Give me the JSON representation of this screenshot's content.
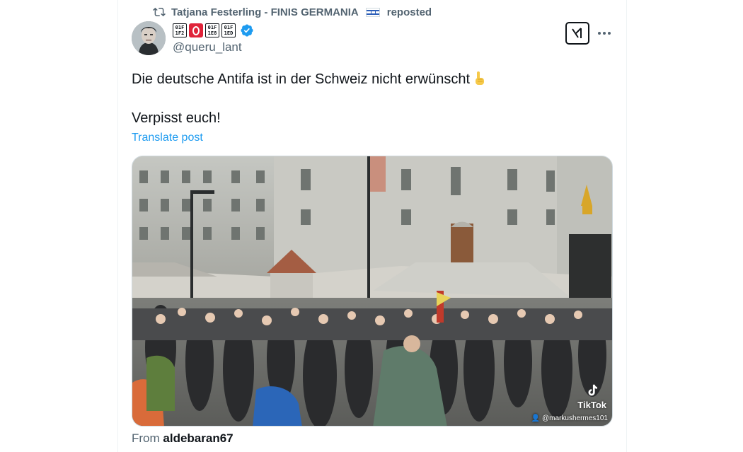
{
  "repost": {
    "user": "Tatjana Festerling - FINIS GERMANIA",
    "flag": "flag-israel-icon",
    "label": "reposted"
  },
  "author": {
    "name_glyphs": [
      "01F\n1F2",
      "01F\n1E8",
      "01F\n1ED"
    ],
    "name_glyph_icons": [
      "regional-indicator-box",
      "red-o-circle-icon",
      "regional-indicator-box",
      "regional-indicator-box"
    ],
    "verified": true,
    "handle": "@queru_lant"
  },
  "post": {
    "line1": "Die deutsche Antifa ist in der Schweiz nicht erwünscht",
    "line1_emoji": "pointing-up-finger-emoji",
    "line2": "Verpisst euch!",
    "translate_label": "Translate post"
  },
  "media": {
    "watermark": "TikTok",
    "watermark_user": "@markushermes101"
  },
  "source": {
    "prefix": "From",
    "account": "aldebaran67"
  },
  "colors": {
    "link": "#1d9bf0",
    "secondary_text": "#536471",
    "verified": "#1d9bf0",
    "primary_text": "#0f1419"
  }
}
